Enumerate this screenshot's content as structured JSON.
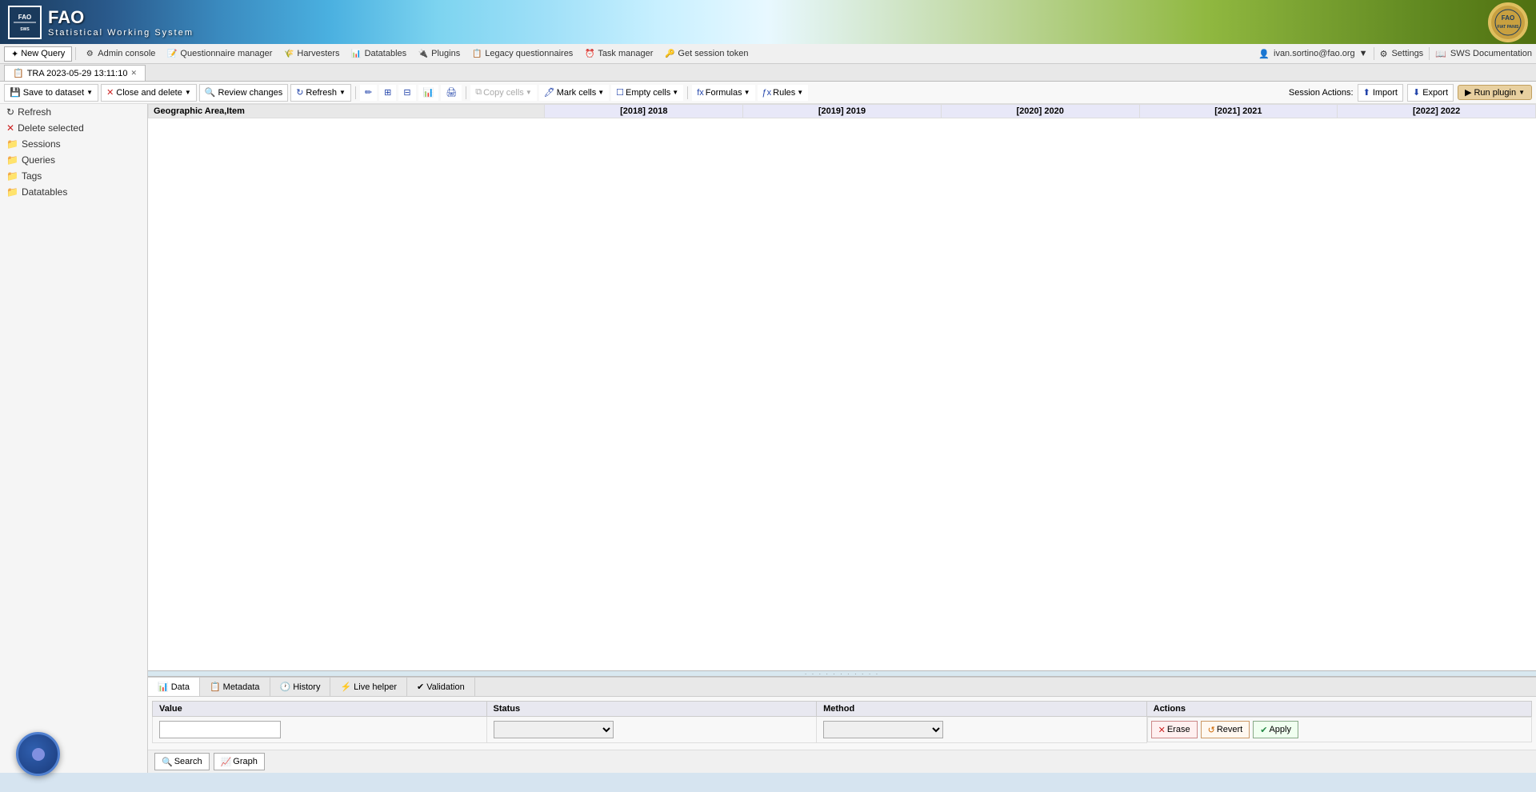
{
  "app": {
    "title": "FAO",
    "subtitle": "Statistical  Working  System",
    "fao_logo_text": "FAO"
  },
  "top_nav": {
    "new_query": "New Query",
    "admin_console": "Admin console",
    "questionnaire_manager": "Questionnaire manager",
    "harvesters": "Harvesters",
    "datatables": "Datatables",
    "plugins": "Plugins",
    "legacy_questionnaires": "Legacy questionnaires",
    "task_manager": "Task manager",
    "get_session_token": "Get session token",
    "user": "ivan.sortino@fao.org",
    "settings": "Settings",
    "sws_documentation": "SWS Documentation"
  },
  "tab": {
    "label": "TRA 2023-05-29 13:11:10",
    "icon": "📋"
  },
  "action_bar": {
    "save_to_dataset": "Save to dataset",
    "close_and_delete": "Close and delete",
    "review_changes": "Review changes",
    "refresh": "Refresh",
    "session_actions_label": "Session Actions:",
    "import": "Import",
    "export": "Export",
    "run_plugin": "Run plugin"
  },
  "toolbar": {
    "copy_cells": "Copy cells",
    "mark_cells": "Mark cells",
    "empty_cells": "Empty cells",
    "formulas": "Formulas",
    "rules": "Rules"
  },
  "sidebar": {
    "items": [
      {
        "label": "Sessions",
        "icon": "🗂",
        "level": 0
      },
      {
        "label": "Queries",
        "icon": "🔍",
        "level": 0
      },
      {
        "label": "Tags",
        "icon": "🏷",
        "level": 0
      },
      {
        "label": "Datatables",
        "icon": "📊",
        "level": 0
      }
    ]
  },
  "spreadsheet": {
    "row_header": "Geographic Area,Item",
    "columns": [
      {
        "id": "2018",
        "label": "[2018] 2018"
      },
      {
        "id": "2019",
        "label": "[2019] 2019"
      },
      {
        "id": "2020",
        "label": "[2020] 2020"
      },
      {
        "id": "2021",
        "label": "[2021] 2021"
      },
      {
        "id": "2022",
        "label": "[2022] 2022"
      }
    ]
  },
  "bottom_panel": {
    "tabs": [
      {
        "label": "Data",
        "icon": "📊",
        "active": true
      },
      {
        "label": "Metadata",
        "icon": "📋",
        "active": false
      },
      {
        "label": "History",
        "icon": "🕐",
        "active": false
      },
      {
        "label": "Live helper",
        "icon": "⚡",
        "active": false
      },
      {
        "label": "Validation",
        "icon": "✔",
        "active": false
      }
    ],
    "table_headers": {
      "value": "Value",
      "status": "Status",
      "method": "Method",
      "actions": "Actions"
    },
    "buttons": {
      "erase": "Erase",
      "revert": "Revert",
      "apply": "Apply"
    }
  },
  "bottom_nav": {
    "search_label": "Search",
    "graph_label": "Graph"
  }
}
